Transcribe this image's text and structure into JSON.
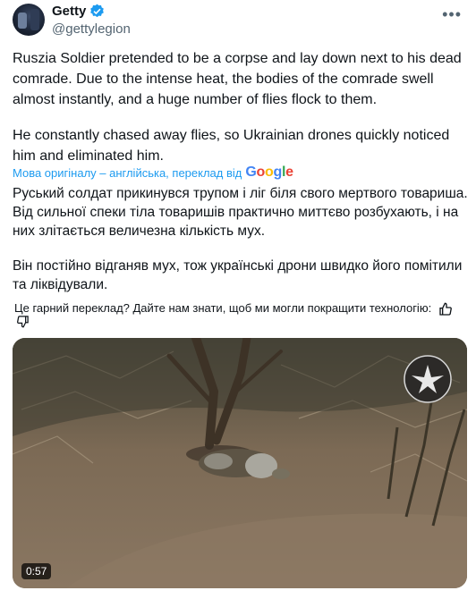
{
  "author": {
    "display_name": "Getty",
    "handle": "@gettylegion",
    "verified": true,
    "avatar_icon": "avatar-photo"
  },
  "tweet": {
    "paragraphs": [
      "Ruszia Soldier pretended to be a corpse and lay down next to his dead comrade. Due to the intense heat, the bodies of the comrade swell almost instantly, and a huge number of flies flock to them.",
      "He constantly chased away flies, so Ukrainian drones quickly noticed him and eliminated him."
    ]
  },
  "translation_bar": {
    "label": "Мова оригіналу – англійська, переклад від",
    "provider": "Google"
  },
  "translation": {
    "paragraphs": [
      "Руський солдат прикинувся трупом і ліг біля свого мертвого товариша. Від сильної спеки тіла товаришів практично миттєво розбухають, і на них злітається величезна кількість мух.",
      "Він постійно відганяв мух, тож українські дрони швидко його помітили та ліквідували."
    ]
  },
  "feedback": {
    "question": "Це гарний переклад? Дайте нам знати, щоб ми могли покращити технологію:"
  },
  "media": {
    "duration": "0:57",
    "type": "video"
  },
  "colors": {
    "link": "#1d9bf0",
    "text": "#0f1419",
    "secondary": "#536471"
  }
}
